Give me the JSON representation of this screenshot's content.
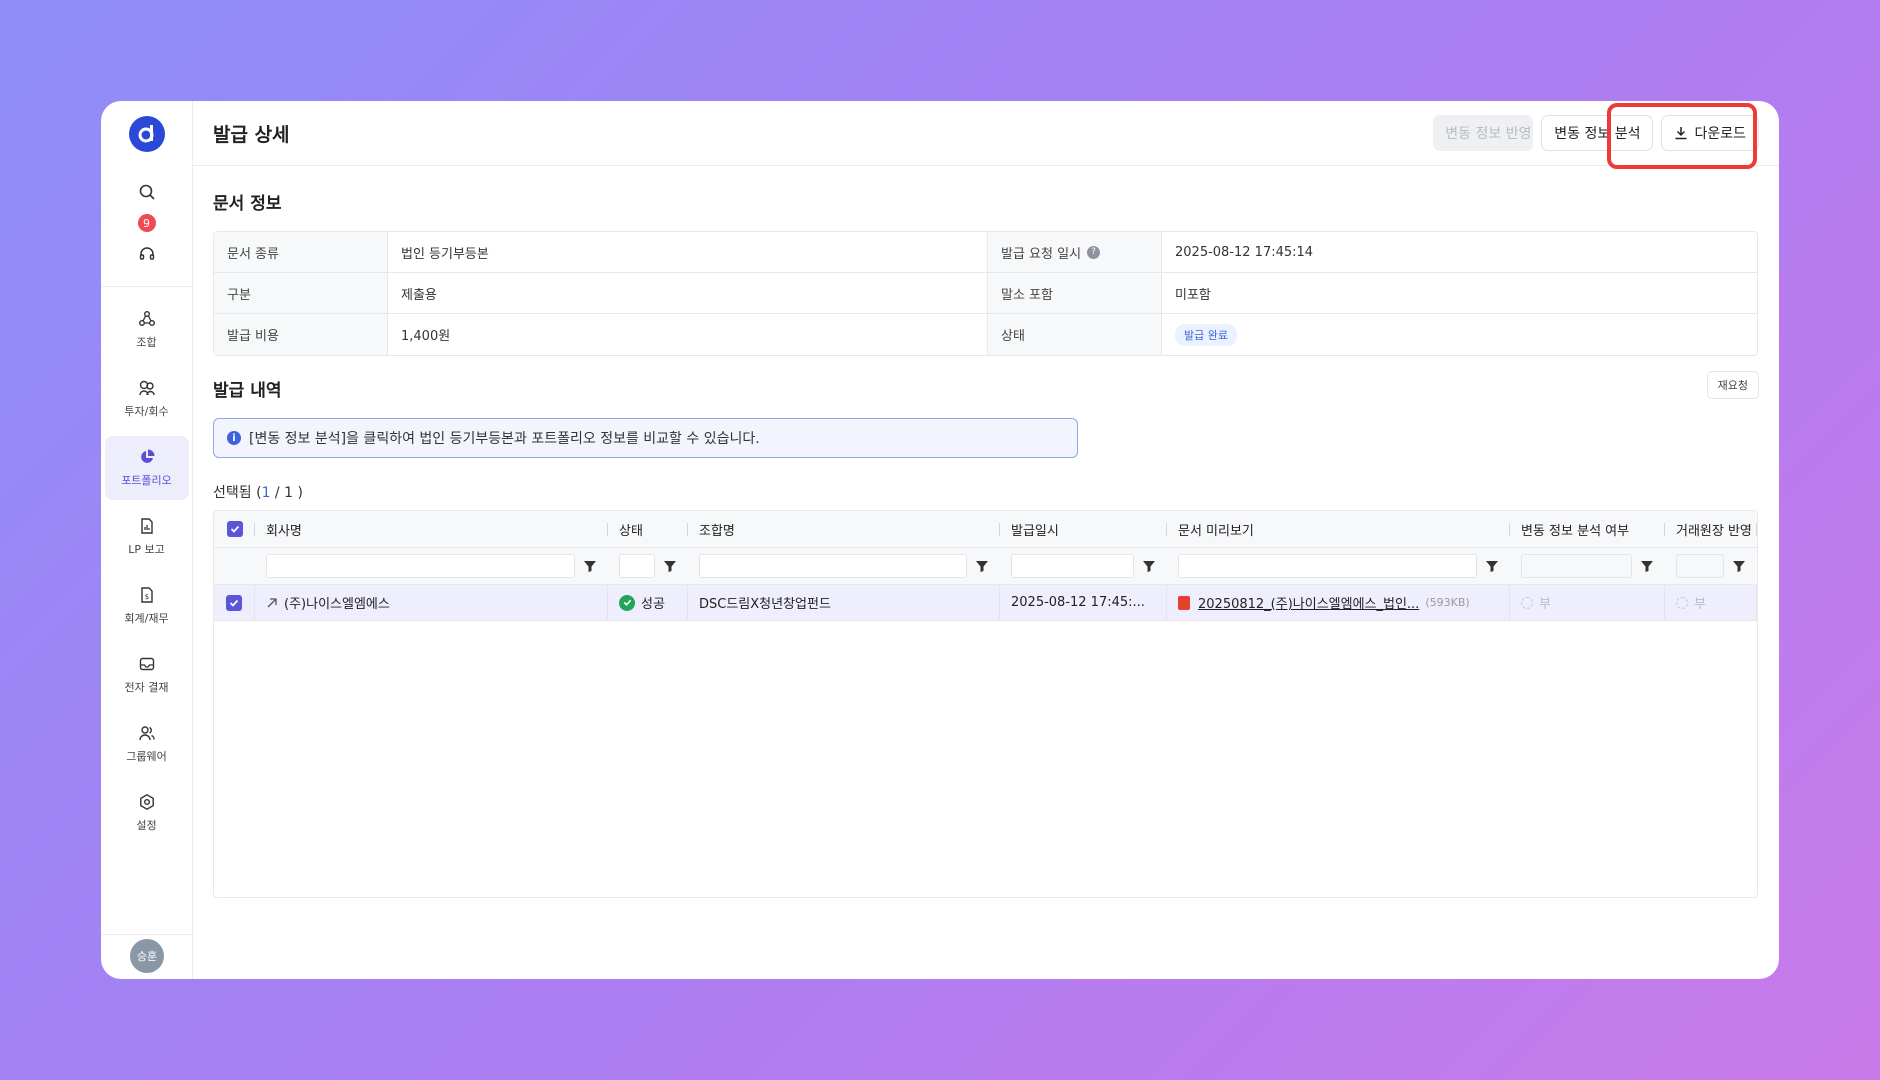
{
  "sidebar": {
    "logo": "d",
    "notification_count": "9",
    "items": [
      {
        "label": "조합",
        "icon": "network-icon",
        "active": false
      },
      {
        "label": "투자/회수",
        "icon": "invest-icon",
        "active": false
      },
      {
        "label": "포트폴리오",
        "icon": "pie-chart-icon",
        "active": true
      },
      {
        "label": "LP 보고",
        "icon": "report-icon",
        "active": false
      },
      {
        "label": "회계/재무",
        "icon": "finance-icon",
        "active": false
      },
      {
        "label": "전자 결재",
        "icon": "inbox-icon",
        "active": false
      },
      {
        "label": "그룹웨어",
        "icon": "people-icon",
        "active": false
      },
      {
        "label": "설정",
        "icon": "gear-icon",
        "active": false
      }
    ],
    "avatar": "승훈"
  },
  "header": {
    "title": "발급 상세",
    "btn_reflect": "변동 정보 반영",
    "btn_analyze": "변동 정보 분석",
    "btn_download": "다운로드"
  },
  "doc_info": {
    "title": "문서 정보",
    "rows": [
      {
        "l1": "문서 종류",
        "v1": "법인 등기부등본",
        "l2": "발급 요청 일시",
        "v2": "2025-08-12 17:45:14"
      },
      {
        "l1": "구분",
        "v1": "제출용",
        "l2": "말소 포함",
        "v2": "미포함"
      },
      {
        "l1": "발급 비용",
        "v1": "1,400원",
        "l2": "상태",
        "v2": "발급 완료"
      }
    ]
  },
  "history": {
    "title": "발급 내역",
    "reissue_btn": "재요청",
    "notice": "[변동 정보 분석]을 클릭하여 법인 등기부등본과 포트폴리오 정보를 비교할 수 있습니다.",
    "selected_prefix": "선택됨 (",
    "selected_num": "1",
    "selected_sep": " / ",
    "selected_total": "1",
    "selected_suffix": " )",
    "columns": [
      "회사명",
      "상태",
      "조합명",
      "발급일시",
      "문서 미리보기",
      "변동 정보 분석 여부",
      "거래원장 반영 여부"
    ],
    "rows": [
      {
        "company": "(주)나이스엘엠에스",
        "status": "성공",
        "fund": "DSC드림X청년창업펀드",
        "date": "2025-08-12 17:45:...",
        "file": "20250812_(주)나이스엘엠에스_법인...",
        "file_size": "(593KB)",
        "analyzed": "부",
        "reflected": "부"
      }
    ]
  }
}
